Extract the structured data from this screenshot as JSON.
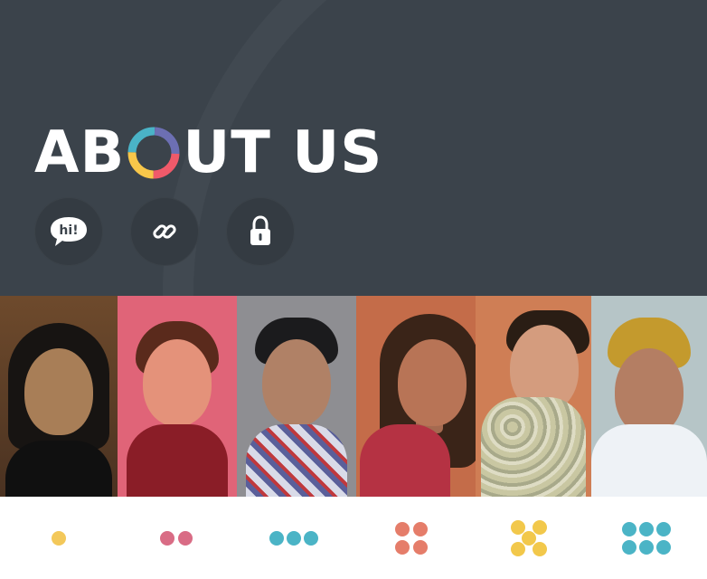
{
  "header": {
    "title_before": "AB",
    "title_after": "UT US",
    "title_ring_colors": [
      "#f05a6a",
      "#f8c74a",
      "#4ab3c7",
      "#6c6fb3"
    ],
    "background_color": "#3b434b"
  },
  "actions": [
    {
      "name": "chat-icon",
      "label": "hi!"
    },
    {
      "name": "link-icon"
    },
    {
      "name": "lock-icon"
    }
  ],
  "team_photos": [
    {
      "name": "team-photo-1"
    },
    {
      "name": "team-photo-2"
    },
    {
      "name": "team-photo-3"
    },
    {
      "name": "team-photo-4"
    },
    {
      "name": "team-photo-5"
    },
    {
      "name": "team-photo-6"
    }
  ],
  "dot_groups": [
    {
      "count": 1,
      "color": "#f3c85a"
    },
    {
      "count": 2,
      "color": "#d96c85"
    },
    {
      "count": 3,
      "color": "#4bb4c6"
    },
    {
      "count": 4,
      "color": "#e57d6a"
    },
    {
      "count": 5,
      "color": "#f2c84b"
    },
    {
      "count": 6,
      "color": "#4bb4c6"
    }
  ]
}
